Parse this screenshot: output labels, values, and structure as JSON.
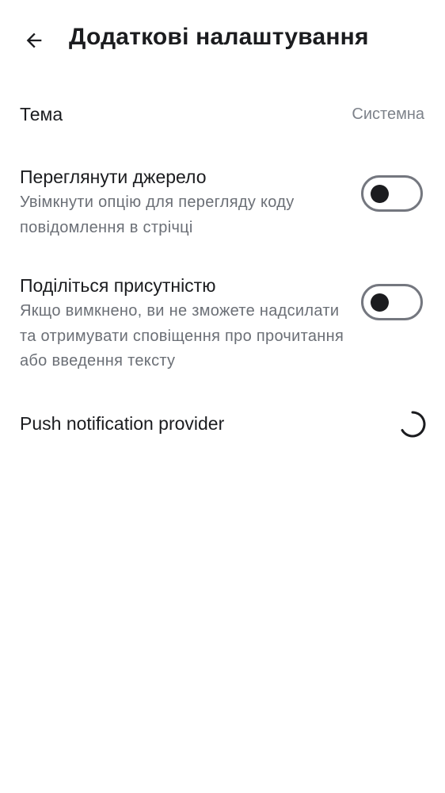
{
  "header": {
    "title": "Додаткові налаштування",
    "back_icon": "arrow-back-icon"
  },
  "settings": {
    "theme": {
      "label": "Тема",
      "value": "Системна"
    },
    "view_source": {
      "label": "Переглянути джерело",
      "description": "Увімкнути опцію для перегляду коду повідомлення в стрічці",
      "enabled": false
    },
    "share_presence": {
      "label": "Поділіться присутністю",
      "description": "Якщо вимкнено, ви не зможете надсилати та отримувати сповіщення про прочитання або введення тексту",
      "enabled": false
    },
    "push_provider": {
      "label": "Push notification provider",
      "status_icon": "loading-spinner-icon"
    }
  },
  "colors": {
    "text_primary": "#1b1c1f",
    "text_secondary": "#6b6f76",
    "switch_outline": "#74777f",
    "background": "#ffffff"
  }
}
